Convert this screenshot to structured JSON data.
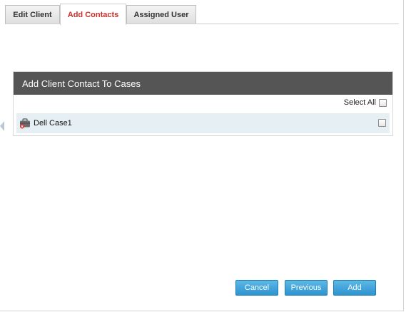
{
  "tabs": [
    {
      "label": "Edit Client"
    },
    {
      "label": "Add Contacts"
    },
    {
      "label": "Assigned User"
    }
  ],
  "active_tab": "Add Contacts",
  "panel": {
    "title": "Add Client Contact To Cases",
    "select_all_label": "Select All",
    "rows": [
      {
        "label": "Dell Case1",
        "icon": "briefcase-icon",
        "checked": false
      }
    ]
  },
  "buttons": {
    "cancel": "Cancel",
    "previous": "Previous",
    "add": "Add"
  },
  "colors": {
    "active_tab_text": "#c9302c",
    "panel_header_bg": "#555555",
    "row_bg": "#e5eff4",
    "button_bg": "#2e93cf"
  }
}
